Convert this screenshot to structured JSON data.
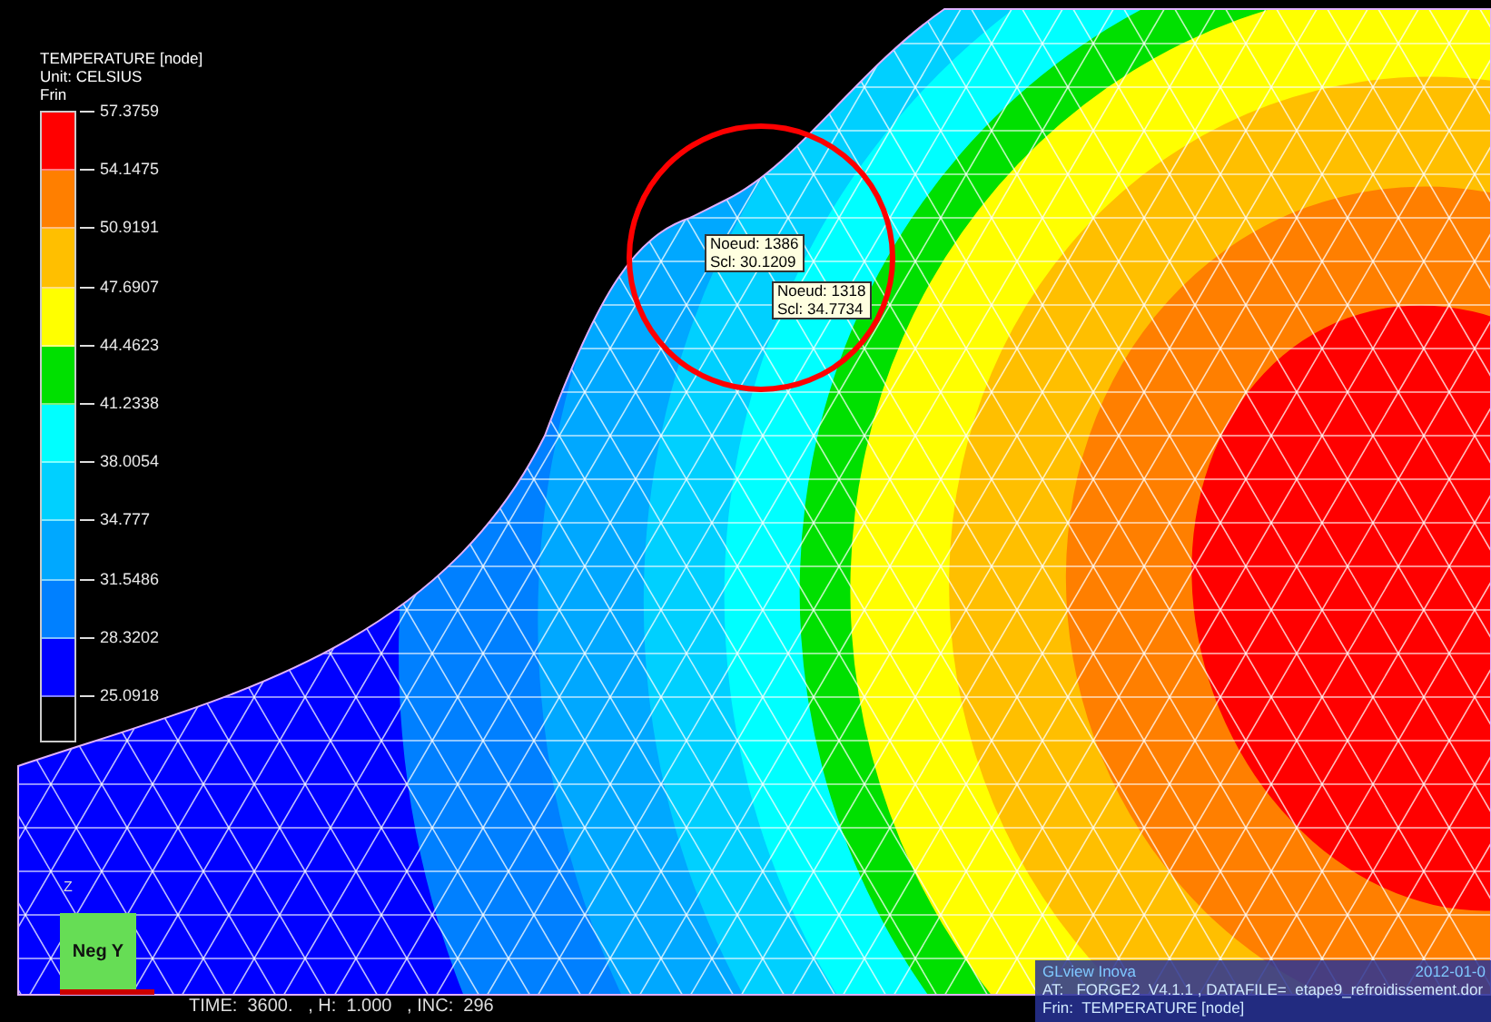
{
  "legend": {
    "title": "TEMPERATURE [node]",
    "unit": "Unit: CELSIUS",
    "field": "Frin",
    "bands": [
      {
        "color": "#ff0000"
      },
      {
        "color": "#ff7f00"
      },
      {
        "color": "#ffbf00"
      },
      {
        "color": "#ffff00"
      },
      {
        "color": "#00e000"
      },
      {
        "color": "#00ffff"
      },
      {
        "color": "#00d0ff"
      },
      {
        "color": "#00a8ff"
      },
      {
        "color": "#0080ff"
      },
      {
        "color": "#0000ff"
      }
    ],
    "values": [
      "57.3759",
      "54.1475",
      "50.9191",
      "47.6907",
      "44.4623",
      "41.2338",
      "38.0054",
      "34.777",
      "31.5486",
      "28.3202",
      "25.0918"
    ]
  },
  "probes": [
    {
      "node": "Noeud: 1386",
      "value": "Scl: 30.1209"
    },
    {
      "node": "Noeud: 1318",
      "value": "Scl: 34.7734"
    }
  ],
  "triad": {
    "axis": "Z",
    "view": "Neg Y"
  },
  "status": "TIME:  3600.   , H:  1.000   , INC:  296",
  "info": {
    "title": "GLview Inova",
    "date": "2012-01-0",
    "lines": [
      "AT:   FORGE2  V4.1.1 , DATAFILE=  etape9_refroidissement.dor",
      "Frin:  TEMPERATURE [node]"
    ]
  }
}
